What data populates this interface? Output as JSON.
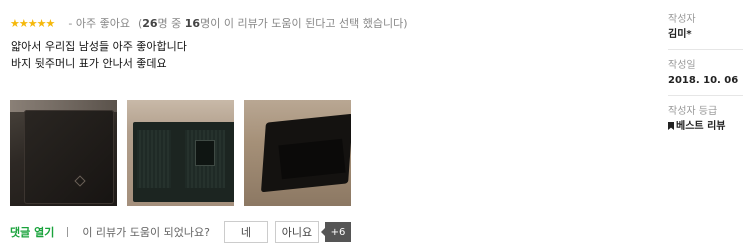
{
  "review": {
    "star_count": 5,
    "rating_text": "- 아주 좋아요",
    "helpful_summary": {
      "prefix": "(",
      "helpful_count": "26",
      "mid1": "명 중 ",
      "total_count": "16",
      "suffix": "명이 이 리뷰가 도움이 된다고 선택 했습니다)"
    },
    "body_lines": [
      "얇아서 우리집 남성들 아주 좋아합니다",
      "바지 뒷주머니 표가 안나서 좋데요"
    ],
    "photos": [
      {
        "alt": "wallet-closed"
      },
      {
        "alt": "wallet-open-inside"
      },
      {
        "alt": "wallet-angled"
      }
    ],
    "actions": {
      "comment_toggle": "댓글 열기",
      "separator": "|",
      "helpful_question": "이 리뷰가 도움이 되었나요?",
      "yes_label": "네",
      "no_label": "아니요",
      "helpful_badge": "+6"
    }
  },
  "meta": {
    "author_label": "작성자",
    "author_value": "김미*",
    "date_label": "작성일",
    "date_value": "2018. 10. 06",
    "grade_label": "작성자 등급",
    "grade_icon": "bookmark-icon",
    "grade_value": "베스트 리뷰"
  },
  "colors": {
    "star": "#f5b80b",
    "comment_toggle": "#1aa33c",
    "badge_bg": "#555555"
  }
}
